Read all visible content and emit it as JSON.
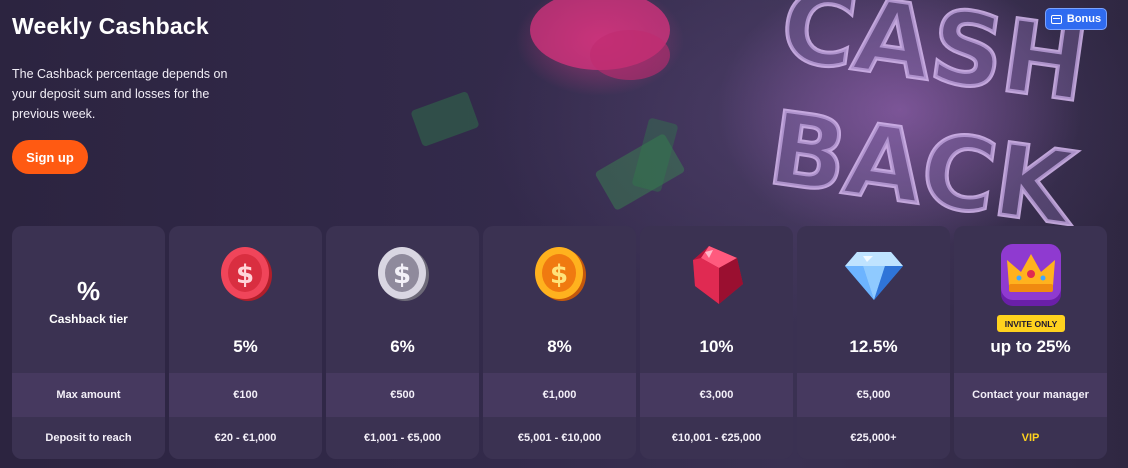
{
  "header": {
    "title": "Weekly Cashback",
    "description": "The Cashback percentage depends on your deposit sum and losses for the previous week.",
    "signup_label": "Sign up",
    "badge_label": "Bonus"
  },
  "colors": {
    "accent": "#ff5a12",
    "badge": "#2f6bf0",
    "vip": "#ffd21e",
    "card": "#3b3252"
  },
  "table": {
    "header": {
      "symbol": "%",
      "tier_label": "Cashback tier",
      "max_label": "Max amount",
      "deposit_label": "Deposit to reach"
    },
    "tiers": [
      {
        "icon": "red-coin-icon",
        "percent": "5%",
        "max": "€100",
        "deposit": "€20 - €1,000"
      },
      {
        "icon": "silver-coin-icon",
        "percent": "6%",
        "max": "€500",
        "deposit": "€1,001 - €5,000"
      },
      {
        "icon": "gold-coin-icon",
        "percent": "8%",
        "max": "€1,000",
        "deposit": "€5,001 - €10,000"
      },
      {
        "icon": "ruby-gem-icon",
        "percent": "10%",
        "max": "€3,000",
        "deposit": "€10,001 - €25,000"
      },
      {
        "icon": "diamond-icon",
        "percent": "12.5%",
        "max": "€5,000",
        "deposit": "€25,000+"
      },
      {
        "icon": "crown-icon",
        "badge": "INVITE ONLY",
        "percent": "up to 25%",
        "max": "Contact your manager",
        "deposit": "VIP"
      }
    ]
  }
}
